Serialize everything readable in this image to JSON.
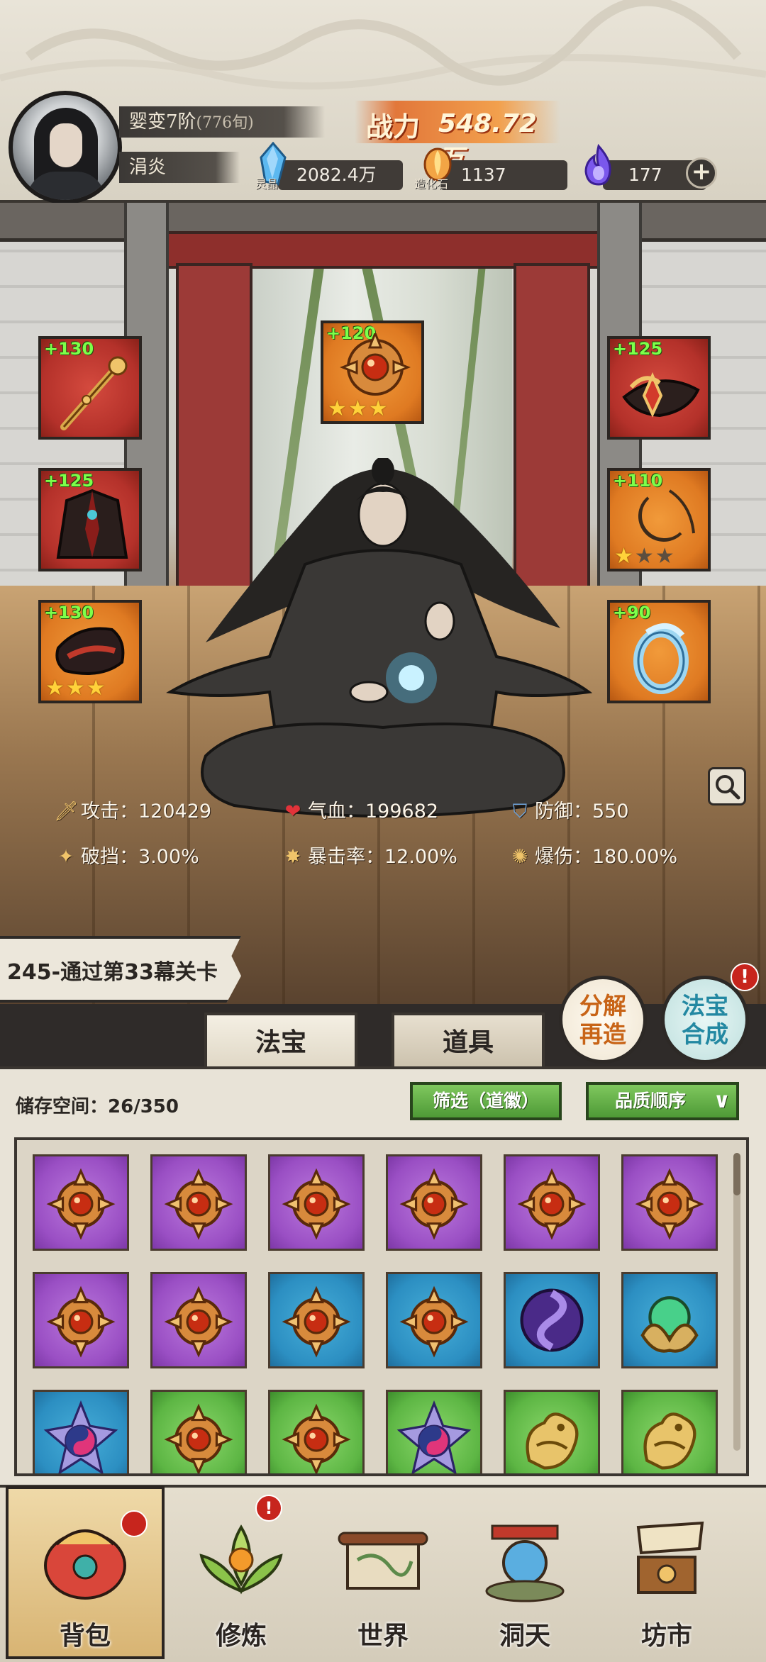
{
  "header": {
    "realm": "婴变7阶",
    "realm_sub": "(776旬)",
    "player_name": "涓炎",
    "power_label": "战力",
    "power_value": "548.72万",
    "resources": [
      {
        "name": "灵晶",
        "value": "2082.4万",
        "icon": "blue-crystal-icon",
        "color": "#4aa6e6"
      },
      {
        "name": "造化石",
        "value": "1137",
        "icon": "fire-stone-icon",
        "color": "#e88a2a"
      },
      {
        "name": "",
        "value": "177",
        "icon": "purple-flame-icon",
        "color": "#7b52e6"
      }
    ],
    "add_label": "+"
  },
  "equipment": {
    "top_center": {
      "bonus": "+120",
      "stars": 3,
      "max_stars": 3,
      "rarity": "orange"
    },
    "left": [
      {
        "bonus": "+130",
        "stars": 0,
        "max_stars": 0,
        "rarity": "red"
      },
      {
        "bonus": "+125",
        "stars": 0,
        "max_stars": 0,
        "rarity": "red"
      },
      {
        "bonus": "+130",
        "stars": 3,
        "max_stars": 3,
        "rarity": "orange"
      }
    ],
    "right": [
      {
        "bonus": "+125",
        "stars": 0,
        "max_stars": 0,
        "rarity": "red"
      },
      {
        "bonus": "+110",
        "stars": 1,
        "max_stars": 3,
        "rarity": "orange"
      },
      {
        "bonus": "+90",
        "stars": 0,
        "max_stars": 0,
        "rarity": "orange"
      }
    ]
  },
  "stats": [
    {
      "label": "攻击：",
      "value": "120429",
      "icon": "sword-icon"
    },
    {
      "label": "气血：",
      "value": "199682",
      "icon": "heart-icon"
    },
    {
      "label": "防御：",
      "value": "550",
      "icon": "shield-icon"
    },
    {
      "label": "破挡：",
      "value": "3.00%",
      "icon": "break-shield-icon"
    },
    {
      "label": "暴击率：",
      "value": "12.00%",
      "icon": "crit-icon"
    },
    {
      "label": "爆伤：",
      "value": "180.00%",
      "icon": "crit-damage-icon"
    }
  ],
  "quest": "245-通过第33幕关卡",
  "actions": {
    "decompose_line1": "分解",
    "decompose_line2": "再造",
    "synth_line1": "法宝",
    "synth_line2": "合成",
    "synth_alert": "!"
  },
  "tabs": {
    "fabao": "法宝",
    "daoju": "道具"
  },
  "bag": {
    "storage_label": "储存空间：",
    "storage_value": "26/350",
    "filter_label": "筛选（道徽）",
    "sort_label": "品质顺序",
    "items": [
      {
        "rarity": "purple",
        "icon": "sun-medallion-icon"
      },
      {
        "rarity": "purple",
        "icon": "sun-medallion-icon"
      },
      {
        "rarity": "purple",
        "icon": "sun-medallion-icon"
      },
      {
        "rarity": "purple",
        "icon": "sun-medallion-icon"
      },
      {
        "rarity": "purple",
        "icon": "sun-medallion-icon"
      },
      {
        "rarity": "purple",
        "icon": "sun-medallion-icon"
      },
      {
        "rarity": "purple",
        "icon": "sun-medallion-icon"
      },
      {
        "rarity": "purple",
        "icon": "sun-medallion-icon"
      },
      {
        "rarity": "blue",
        "icon": "sun-medallion-icon"
      },
      {
        "rarity": "blue",
        "icon": "sun-medallion-icon"
      },
      {
        "rarity": "blue",
        "icon": "swirl-orb-icon"
      },
      {
        "rarity": "blue",
        "icon": "jade-orb-icon"
      },
      {
        "rarity": "blue",
        "icon": "yin-yang-star-icon"
      },
      {
        "rarity": "green",
        "icon": "sun-medallion-icon"
      },
      {
        "rarity": "green",
        "icon": "sun-medallion-icon"
      },
      {
        "rarity": "green",
        "icon": "yin-yang-star-icon"
      },
      {
        "rarity": "green",
        "icon": "golden-dragon-icon"
      },
      {
        "rarity": "green",
        "icon": "golden-dragon-icon"
      }
    ]
  },
  "nav": [
    {
      "label": "背包",
      "icon": "backpack-icon",
      "alert": true,
      "active": true
    },
    {
      "label": "修炼",
      "icon": "lotus-orb-icon",
      "alert": true,
      "active": false
    },
    {
      "label": "世界",
      "icon": "scroll-map-icon",
      "alert": false,
      "active": false
    },
    {
      "label": "洞天",
      "icon": "portal-icon",
      "alert": false,
      "active": false
    },
    {
      "label": "坊市",
      "icon": "market-icon",
      "alert": false,
      "active": false
    }
  ]
}
